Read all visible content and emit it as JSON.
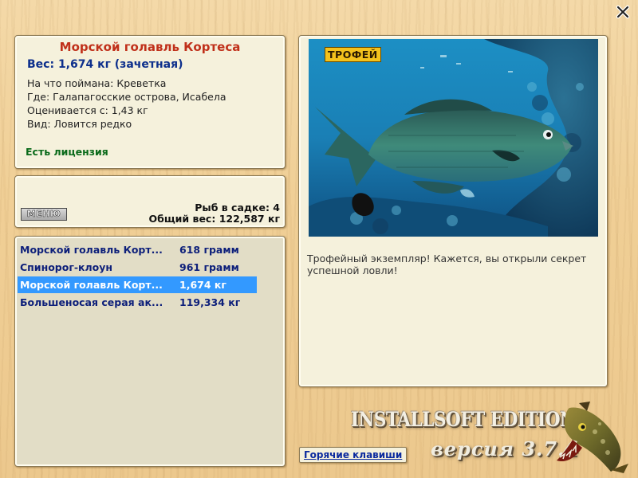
{
  "info": {
    "title": "Морской голавль Кортеса",
    "weight": "Вес: 1,674 кг (зачетная)",
    "bait": "На что поймана: Креветка",
    "location": "Где: Галапагосские острова, Исабела",
    "valued_from": "Оценивается с: 1,43 кг",
    "kind": "Вид: Ловится редко",
    "license": "Есть лицензия"
  },
  "stats": {
    "menu_label": "МЕНЮ",
    "fish_in_keepnet": "Рыб в садке: 4",
    "total_weight": "Общий вес: 122,587 кг"
  },
  "catch_list": [
    {
      "name": "Морской голавль Корт...",
      "weight": "618 грамм",
      "selected": false
    },
    {
      "name": "Спинорог-клоун",
      "weight": "961 грамм",
      "selected": false
    },
    {
      "name": "Морской голавль Корт...",
      "weight": "1,674 кг",
      "selected": true
    },
    {
      "name": "Большеносая серая ак...",
      "weight": "119,334 кг",
      "selected": false
    }
  ],
  "photo": {
    "badge": "ТРОФЕЙ",
    "description": "Трофейный экземпляр! Кажется, вы открыли секрет успешной ловли!"
  },
  "footer": {
    "hotkeys": "Горячие клавиши",
    "edition": "INSTALLSOFT EDITION",
    "version": "версия 3.7.4"
  },
  "icons": {
    "close": "close-icon",
    "logo": "pike-fish-logo"
  },
  "colors": {
    "title_red": "#c0301a",
    "weight_blue": "#0d2f8c",
    "license_green": "#0a6a1a",
    "selection_blue": "#3399ff"
  }
}
